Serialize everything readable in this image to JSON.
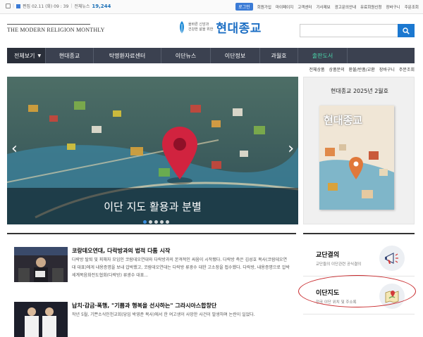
{
  "topbar": {
    "date_label": "편집 02.11 (화) 09 : 39",
    "total_news_label": "전체뉴스",
    "total_news_count": "19,244",
    "login": "로그인",
    "links": [
      "회원가입",
      "마이페이지",
      "고객센터",
      "기사제보",
      "광고문의안내",
      "유료회원신청",
      "장바구니",
      "주문조회"
    ]
  },
  "header": {
    "english_logo": "THE MODERN RELIGION MONTHLY",
    "slogan_line1": "올바른 신앙과",
    "slogan_line2": "건강한 삶을 위한",
    "brand_name": "현대종교",
    "search_placeholder": ""
  },
  "nav": {
    "all_label": "전체보기",
    "items": [
      "현대종교",
      "탁명환자료센터",
      "이단뉴스",
      "이단정보",
      "과월호",
      "출판도서"
    ],
    "active_index": 5
  },
  "subnav": [
    "전체상품",
    "상품문의",
    "환불/반품/교환",
    "장바구니",
    "주문조회"
  ],
  "hero": {
    "caption": "이단 지도 활용과 분별",
    "slide_count": 5,
    "active_slide": 0
  },
  "publication": {
    "title": "현대종교 2025년 2월호",
    "cover_title": "현대종교"
  },
  "news": [
    {
      "headline": "코랑데오연대, 다락방과의 법적 다툼 시작",
      "summary": "다락방 탈퇴 및 피해자 모임인 코람데오연대와 다락방과의 본격적인 싸움이 시작됐다. 다락방 측은 김성호 목사(코람데오연대 대표)에게 내용증명을 보내 압박했고, 코람데오연대는 다락방 류광수 대한 고소장을 접수했다. 다락방, 내용증명으로 압박세계복음화전도협회(다락방) 류광수 대표..."
    },
    {
      "headline": "납치·감금·폭행, \"기쁨과 행복을 선사하는\" 그라시아스합창단",
      "summary": "작년 5월, 기쁜소식인천교회(당임 박영준 목사)에서 한 여고생이 사망한 사건이 발생하며 논란이 일었다."
    }
  ],
  "side_cards": [
    {
      "title": "교단결의",
      "desc": "교단들의 이단관련 공식결의"
    },
    {
      "title": "이단지도",
      "desc": "전국 이단 위치 및 주소록"
    }
  ],
  "colors": {
    "nav_bg": "#3b4150",
    "brand": "#1d6fc4",
    "accent_green": "#4ad3a8",
    "highlight_ring": "#c8282b"
  }
}
